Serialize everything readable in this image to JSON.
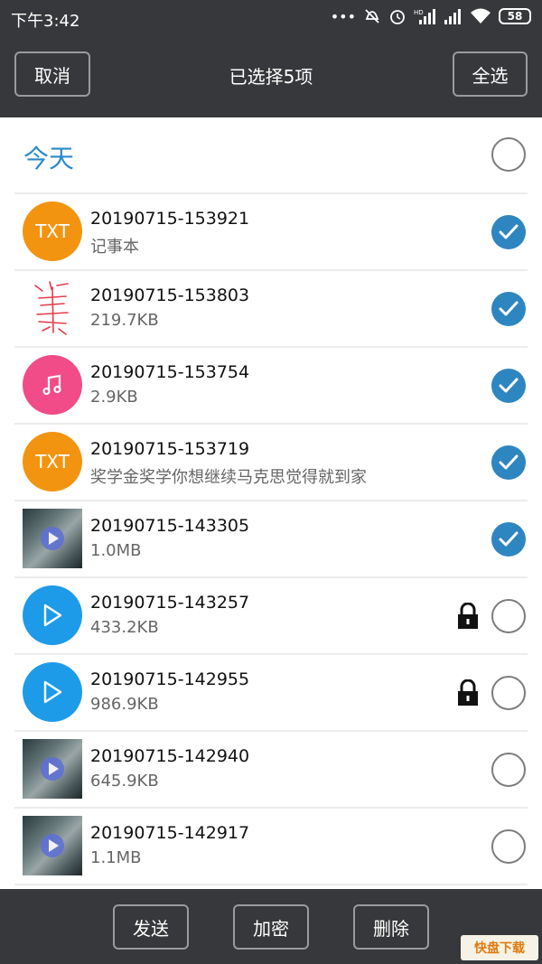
{
  "status": {
    "time": "下午3:42",
    "battery": "58",
    "icons": [
      "more-dots-icon",
      "mute-icon",
      "alarm-icon",
      "signal-hd-icon",
      "signal-icon",
      "wifi-icon"
    ]
  },
  "header": {
    "cancel_label": "取消",
    "title": "已选择5项",
    "select_all_label": "全选"
  },
  "section": {
    "label": "今天"
  },
  "files": [
    {
      "name": "20190715-153921",
      "sub": "记事本",
      "type": "txt",
      "thumb_label": "TXT",
      "checked": true,
      "locked": false
    },
    {
      "name": "20190715-153803",
      "sub": "219.7KB",
      "type": "sketch",
      "thumb_label": "",
      "checked": true,
      "locked": false
    },
    {
      "name": "20190715-153754",
      "sub": "2.9KB",
      "type": "music",
      "thumb_label": "",
      "checked": true,
      "locked": false
    },
    {
      "name": "20190715-153719",
      "sub": "奖学金奖学你想继续马克思觉得就到家",
      "type": "txt",
      "thumb_label": "TXT",
      "checked": true,
      "locked": false
    },
    {
      "name": "20190715-143305",
      "sub": "1.0MB",
      "type": "photo",
      "thumb_label": "",
      "checked": true,
      "locked": false
    },
    {
      "name": "20190715-143257",
      "sub": "433.2KB",
      "type": "video",
      "thumb_label": "",
      "checked": false,
      "locked": true
    },
    {
      "name": "20190715-142955",
      "sub": "986.9KB",
      "type": "video",
      "thumb_label": "",
      "checked": false,
      "locked": true
    },
    {
      "name": "20190715-142940",
      "sub": "645.9KB",
      "type": "photo",
      "thumb_label": "",
      "checked": false,
      "locked": false
    },
    {
      "name": "20190715-142917",
      "sub": "1.1MB",
      "type": "photo",
      "thumb_label": "",
      "checked": false,
      "locked": false
    }
  ],
  "footer": {
    "send_label": "发送",
    "encrypt_label": "加密",
    "delete_label": "删除"
  },
  "watermark": {
    "text": "快盘下载"
  },
  "colors": {
    "bar": "#37383b",
    "accent": "#2e86c1",
    "txt": "#f39410",
    "music": "#f14c88",
    "video": "#1e9be8"
  }
}
